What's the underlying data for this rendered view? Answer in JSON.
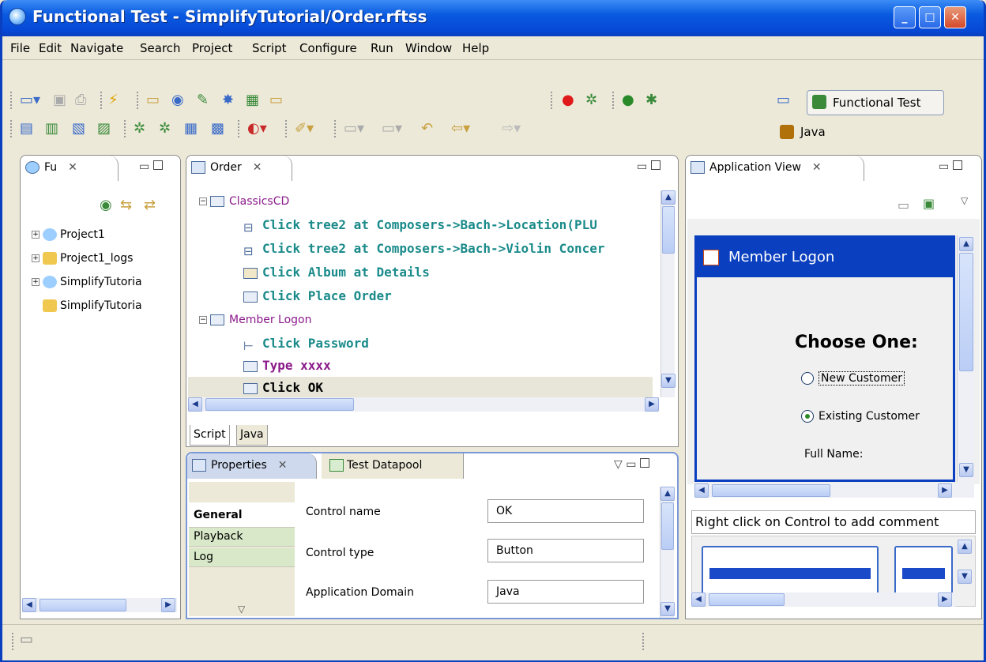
{
  "window": {
    "title": "Functional Test - SimplifyTutorial/Order.rftss"
  },
  "menu": [
    "File",
    "Edit",
    "Navigate",
    "Search",
    "Project",
    "Script",
    "Configure",
    "Run",
    "Window",
    "Help"
  ],
  "perspectives": {
    "active": "Functional Test",
    "other": "Java"
  },
  "navigator": {
    "tab": "Fu",
    "items": [
      "Project1",
      "Project1_logs",
      "SimplifyTutoria",
      "SimplifyTutoria"
    ]
  },
  "script_editor": {
    "tab": "Order",
    "lines": [
      {
        "kind": "group",
        "text": "ClassicsCD"
      },
      {
        "kind": "step",
        "text": "Click tree2 at Composers->Bach->Location(PLU"
      },
      {
        "kind": "step",
        "text": "Click tree2 at Composers->Bach->Violin Concer"
      },
      {
        "kind": "step",
        "text": "Click Album at Details"
      },
      {
        "kind": "step",
        "text": "Click Place Order"
      },
      {
        "kind": "group",
        "text": "Member Logon"
      },
      {
        "kind": "step",
        "text": "Click Password"
      },
      {
        "kind": "step",
        "text": "Type xxxx"
      },
      {
        "kind": "step",
        "text": "Click OK"
      }
    ],
    "subtabs": [
      "Script",
      "Java"
    ]
  },
  "properties": {
    "tabs": [
      "Properties",
      "Test Datapool"
    ],
    "side_tabs": [
      "General",
      "Playback",
      "Log"
    ],
    "rows": [
      {
        "label": "Control name",
        "value": "OK"
      },
      {
        "label": "Control type",
        "value": "Button"
      },
      {
        "label": "Application Domain",
        "value": "Java"
      }
    ]
  },
  "app_view": {
    "tab": "Application View",
    "window_title": "Member Logon",
    "heading": "Choose One:",
    "option1": "New Customer",
    "option2": "Existing Customer",
    "field_label": "Full Name:",
    "comment_hint": "Right click on Control to add comment"
  }
}
